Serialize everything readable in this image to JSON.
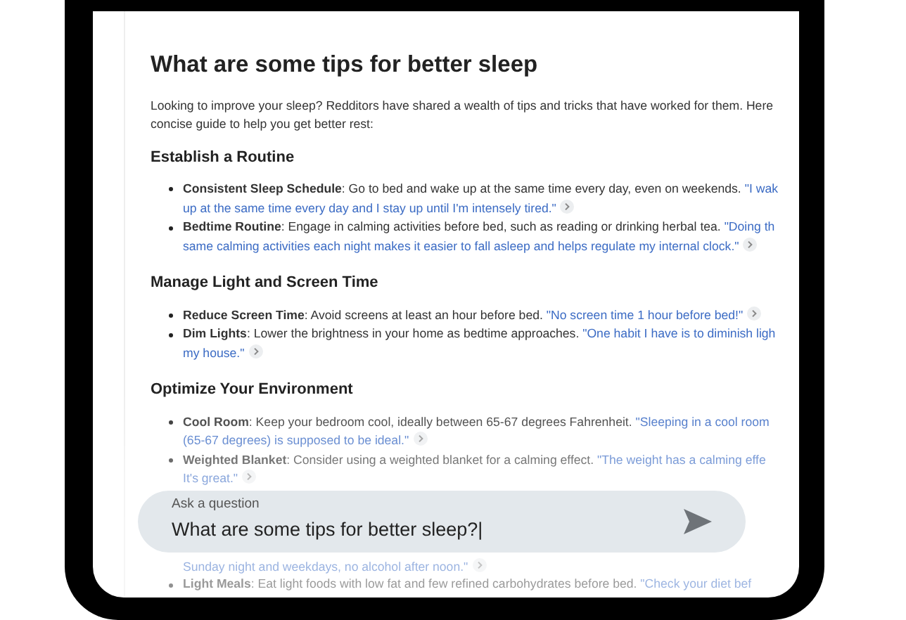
{
  "article": {
    "title": "What are some tips for better sleep",
    "intro": "Looking to improve your sleep? Redditors have shared a wealth of tips and tricks that have worked for them. Here\nconcise guide to help you get better rest:",
    "sections": [
      {
        "heading": "Establish a Routine",
        "items": [
          {
            "kind": "bullet",
            "text": "**Consistent Sleep Schedule**: Go to bed and wake up at the same time every day, even on weekends. ",
            "quote": "\"I wak\nup at the same time every day and I stay up until I'm intensely tired.\""
          },
          {
            "kind": "bullet",
            "text": "**Bedtime Routine**: Engage in calming activities before bed, such as reading or drinking herbal tea. ",
            "quote": "\"Doing th\nsame calming activities each night makes it easier to fall asleep and helps regulate my internal clock.\""
          }
        ]
      },
      {
        "heading": "Manage Light and Screen Time",
        "items": [
          {
            "kind": "bullet",
            "text": "**Reduce Screen Time**: Avoid screens at least an hour before bed. ",
            "quote": "\"No screen time 1 hour before bed!\""
          },
          {
            "kind": "bullet",
            "text": "**Dim Lights**: Lower the brightness in your home as bedtime approaches. ",
            "quote": "\"One habit I have is to diminish ligh\nmy house.\""
          }
        ]
      },
      {
        "heading": "Optimize Your Environment",
        "items": [
          {
            "kind": "bullet",
            "text": "**Cool Room**: Keep your bedroom cool, ideally between 65-67 degrees Fahrenheit. ",
            "quote": "\"Sleeping in a cool room\n(65-67 degrees) is supposed to be ideal.\""
          },
          {
            "kind": "bullet",
            "text": "**Weighted Blanket**: Consider using a weighted blanket for a calming effect. ",
            "quote": "\"The weight has a calming effe\nIt's great.\""
          },
          {
            "kind": "continuation",
            "quote": "Sunday night and weekdays, no alcohol after noon.\""
          },
          {
            "kind": "bullet",
            "text": "**Light Meals**: Eat light foods with low fat and few refined carbohydrates before bed. ",
            "quote": "\"Check your diet bef"
          }
        ]
      }
    ]
  },
  "question_input": {
    "label": "Ask a question",
    "value": "What are some tips for better sleep?|"
  }
}
